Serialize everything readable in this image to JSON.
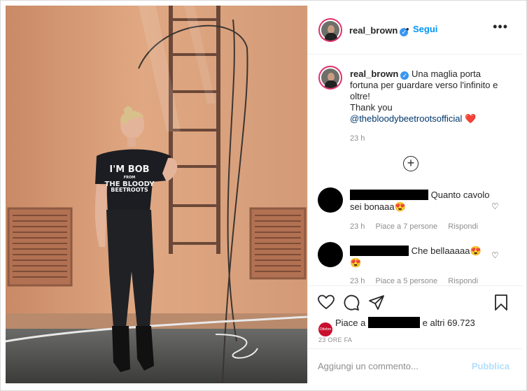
{
  "post": {
    "username": "real_brown",
    "follow_label": "Segui",
    "more_label": "•••",
    "caption_text": "Una maglia porta fortuna per guardare verso l'infinito e oltre!",
    "caption_thanks": "Thank you",
    "caption_mention": "@thebloodybeetrootsofficial",
    "caption_emoji": "❤️",
    "caption_time": "23 h",
    "load_more_label": "+",
    "shirt_text": [
      "I'M BOB",
      "FROM",
      "THE BLOODY",
      "BEETROOTS"
    ]
  },
  "comments": [
    {
      "text": "Quanto cavolo sei bonaaa",
      "emoji": "😍",
      "time": "23 h",
      "likes": "Piace a 7 persone",
      "reply": "Rispondi"
    },
    {
      "text": "Che bellaaaaa",
      "emoji": "😍",
      "emoji2": "😍",
      "time": "23 h",
      "likes": "Piace a 5 persone",
      "reply": "Rispondi"
    }
  ],
  "likes": {
    "prefix": "Piace a",
    "suffix": "e altri 69.723",
    "avatar_label": "Ottobre"
  },
  "posted": "23 ORE FA",
  "add_comment": {
    "placeholder": "Aggiungi un commento...",
    "publish_label": "Pubblica"
  },
  "colors": {
    "accent": "#0095f6",
    "verified": "#3897f0",
    "wall": "#d99a74",
    "heart": "#ed4956"
  },
  "icons": [
    "heart-icon",
    "comment-icon",
    "share-icon",
    "bookmark-icon",
    "verified-icon",
    "plus-circle-icon",
    "more-icon"
  ]
}
